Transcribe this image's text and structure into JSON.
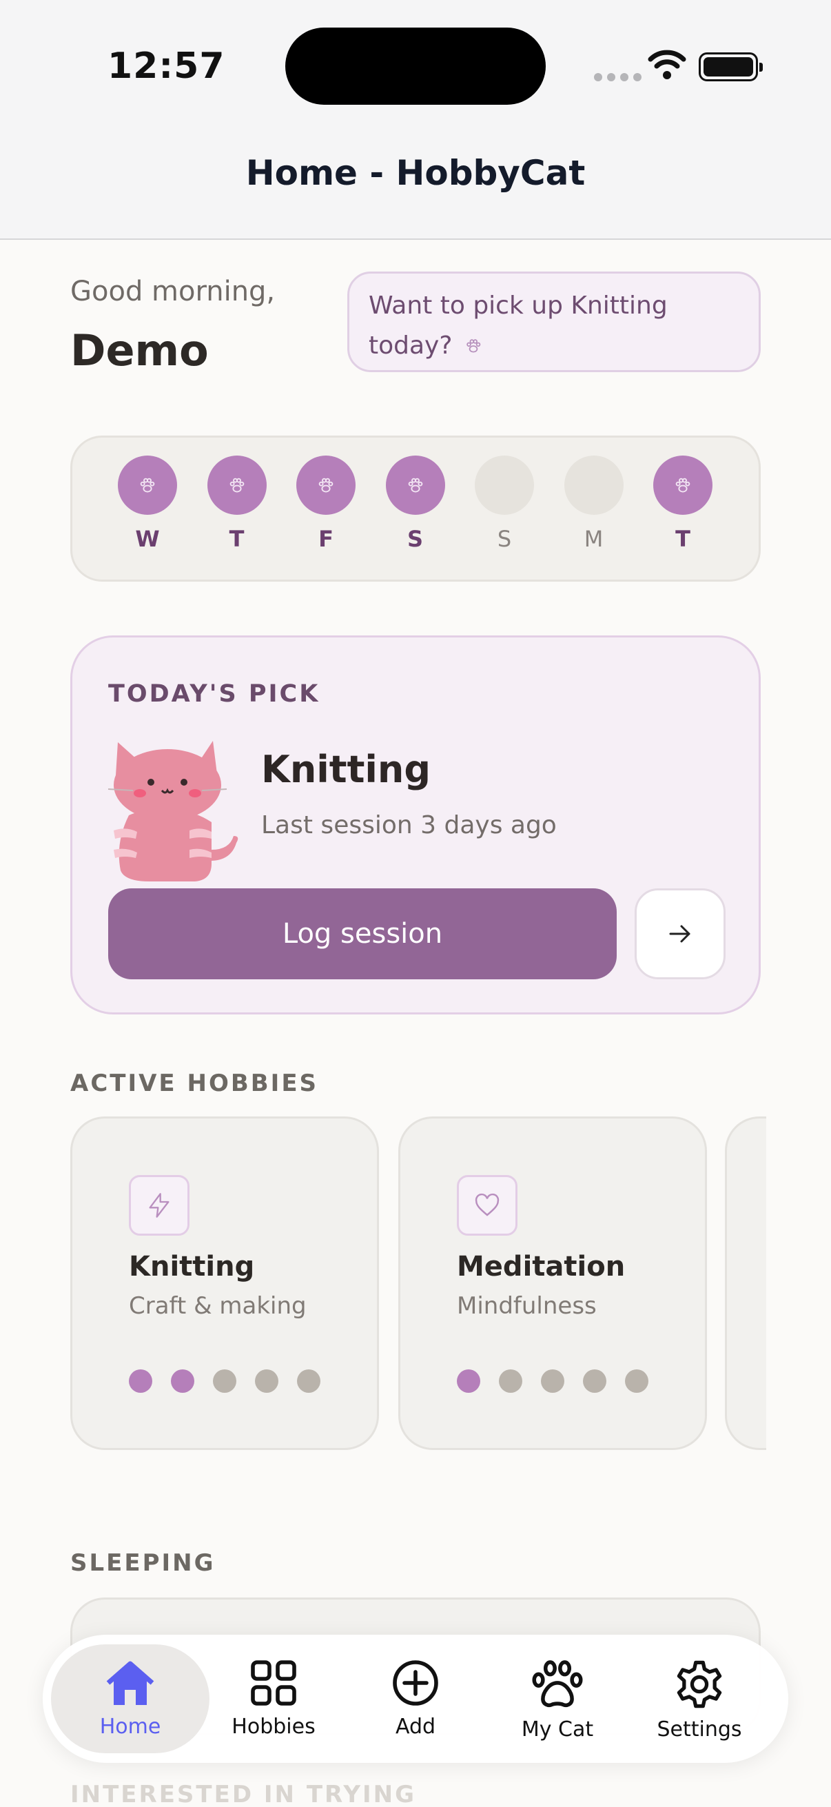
{
  "status": {
    "time": "12:57"
  },
  "nav": {
    "title": "Home - HobbyCat"
  },
  "greeting": {
    "subtitle": "Good morning,",
    "name": "Demo",
    "bubble": "Want to pick up Knitting today?"
  },
  "week": [
    {
      "label": "W",
      "done": true
    },
    {
      "label": "T",
      "done": true
    },
    {
      "label": "F",
      "done": true
    },
    {
      "label": "S",
      "done": true
    },
    {
      "label": "S",
      "done": false
    },
    {
      "label": "M",
      "done": false
    },
    {
      "label": "T",
      "done": true
    }
  ],
  "pick": {
    "tag": "TODAY'S PICK",
    "title": "Knitting",
    "subtitle": "Last session 3 days ago",
    "log_label": "Log session"
  },
  "sections": {
    "active": "ACTIVE HOBBIES",
    "sleeping": "SLEEPING",
    "interested": "INTERESTED IN TRYING"
  },
  "hobbies": [
    {
      "name": "Knitting",
      "category": "Craft & making",
      "icon": "bolt-icon",
      "progress": 2,
      "of": 5
    },
    {
      "name": "Meditation",
      "category": "Mindfulness",
      "icon": "heart-icon",
      "progress": 1,
      "of": 5
    }
  ],
  "tabs": [
    {
      "label": "Home",
      "icon": "home-icon",
      "active": true
    },
    {
      "label": "Hobbies",
      "icon": "grid-icon",
      "active": false
    },
    {
      "label": "Add",
      "icon": "plus-circle-icon",
      "active": false
    },
    {
      "label": "My Cat",
      "icon": "paw-icon",
      "active": false
    },
    {
      "label": "Settings",
      "icon": "gear-icon",
      "active": false
    }
  ],
  "colors": {
    "accent": "#926696",
    "paw_on": "#b57fba",
    "tab_active": "#5b5ff0"
  }
}
